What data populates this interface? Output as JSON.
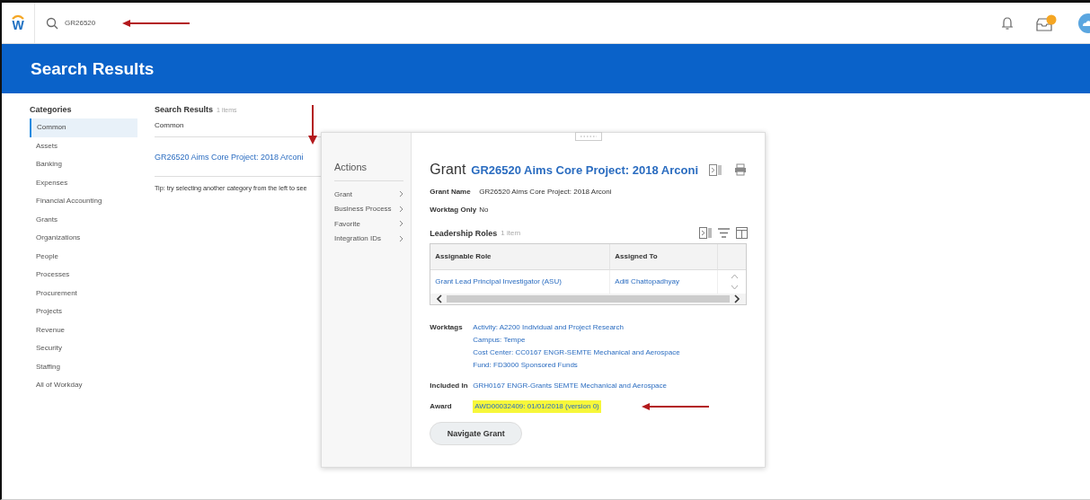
{
  "top_bar": {
    "logo_letter": "W",
    "search": {
      "value": "GR26520"
    }
  },
  "page_title": "Search Results",
  "categories": {
    "heading": "Categories",
    "items": [
      {
        "label": "Common",
        "selected": true
      },
      {
        "label": "Assets",
        "selected": false
      },
      {
        "label": "Banking",
        "selected": false
      },
      {
        "label": "Expenses",
        "selected": false
      },
      {
        "label": "Financial Accounting",
        "selected": false
      },
      {
        "label": "Grants",
        "selected": false
      },
      {
        "label": "Organizations",
        "selected": false
      },
      {
        "label": "People",
        "selected": false
      },
      {
        "label": "Processes",
        "selected": false
      },
      {
        "label": "Procurement",
        "selected": false
      },
      {
        "label": "Projects",
        "selected": false
      },
      {
        "label": "Revenue",
        "selected": false
      },
      {
        "label": "Security",
        "selected": false
      },
      {
        "label": "Staffing",
        "selected": false
      },
      {
        "label": "All of Workday",
        "selected": false
      }
    ]
  },
  "results": {
    "heading": "Search Results",
    "count": "1 items",
    "group": "Common",
    "items": [
      "GR26520 Aims Core Project: 2018 Arconi"
    ],
    "tip": "Tip: try selecting another category from the left to see"
  },
  "popup": {
    "actions": {
      "heading": "Actions",
      "items": [
        "Grant",
        "Business Process",
        "Favorite",
        "Integration IDs"
      ]
    },
    "type": "Grant",
    "title": "GR26520 Aims Core Project: 2018 Arconi",
    "fields": [
      {
        "label": "Grant Name",
        "value": "GR26520 Aims Core Project: 2018 Arconi"
      },
      {
        "label": "Worktag Only",
        "value": "No"
      }
    ],
    "table": {
      "title": "Leadership Roles",
      "count": "1 item",
      "columns": [
        "Assignable Role",
        "Assigned To"
      ],
      "rows": [
        [
          "Grant Lead Principal Investigator (ASU)",
          "Aditi Chattopadhyay"
        ]
      ]
    },
    "details": [
      {
        "label": "Worktags",
        "highlighted": false,
        "values": [
          "Activity: A2200 Individual and Project Research",
          "Campus: Tempe",
          "Cost Center: CC0167 ENGR-SEMTE Mechanical and Aerospace",
          "Fund: FD3000 Sponsored Funds"
        ]
      },
      {
        "label": "Included In",
        "highlighted": false,
        "values": [
          "GRH0167 ENGR-Grants SEMTE Mechanical and Aerospace"
        ]
      },
      {
        "label": "Award",
        "highlighted": true,
        "values": [
          "AWD00032409: 01/01/2018 (version 0)"
        ]
      }
    ],
    "button": "Navigate Grant"
  }
}
